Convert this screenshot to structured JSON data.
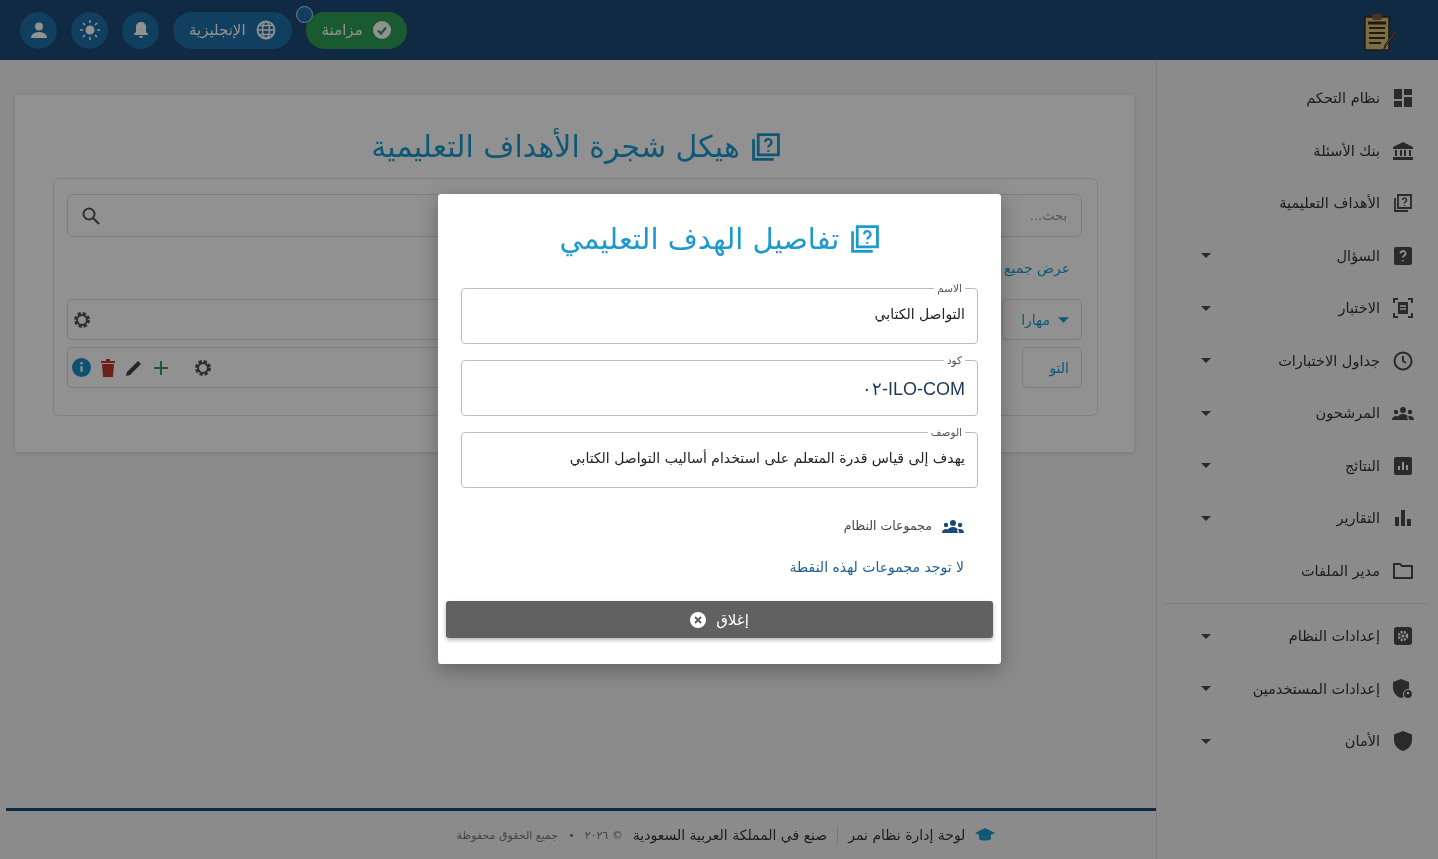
{
  "topbar": {
    "sync_button": {
      "label": "مزامنة",
      "notification": true
    },
    "language_button": {
      "label": "الإنجليزية"
    }
  },
  "sidebar": {
    "items": [
      {
        "label": "نظام التحكم",
        "expandable": false
      },
      {
        "label": "بنك الأسئلة",
        "expandable": false
      },
      {
        "label": "الأهداف التعليمية",
        "expandable": false
      },
      {
        "label": "السؤال",
        "expandable": true
      },
      {
        "label": "الاختبار",
        "expandable": true
      },
      {
        "label": "جداول الاختبارات",
        "expandable": true
      },
      {
        "label": "المرشحون",
        "expandable": true
      },
      {
        "label": "النتائج",
        "expandable": true
      },
      {
        "label": "التقارير",
        "expandable": true
      },
      {
        "label": "مدير الملفات",
        "expandable": false
      }
    ],
    "settings_items": [
      {
        "label": "إعدادات النظام",
        "expandable": true
      },
      {
        "label": "إعدادات المستخدمين",
        "expandable": true
      },
      {
        "label": "الأمان",
        "expandable": true
      }
    ]
  },
  "page": {
    "title": "هيكل شجرة الأهداف التعليمية",
    "search": {
      "placeholder": "بحث..."
    },
    "show_all_link": "عرض جميع",
    "filter_dropdown": "مهارا",
    "tree_node": "التو"
  },
  "dialog": {
    "title": "تفاصيل الهدف التعليمي",
    "fields": [
      {
        "label": "الاسم",
        "value": "التواصل الكتابي"
      },
      {
        "label": "كود",
        "value": "ILO-COM-٠٢"
      },
      {
        "label": "الوصف",
        "value": "يهدف إلى قياس قدرة المتعلم على استخدام أساليب التواصل الكتابي"
      }
    ],
    "groups_heading": "مجموعات النظام",
    "groups_empty": "لا توجد مجموعات لهذه النقطة",
    "close_button": "إغلاق"
  },
  "footer": {
    "brand": "لوحة إدارة نظام نمر",
    "made_in": "صنع في المملكة العربية السعودية",
    "copyright": "© ٢٠٢٦",
    "separator": "•",
    "rights": "جميع الحقوق محفوظة"
  }
}
